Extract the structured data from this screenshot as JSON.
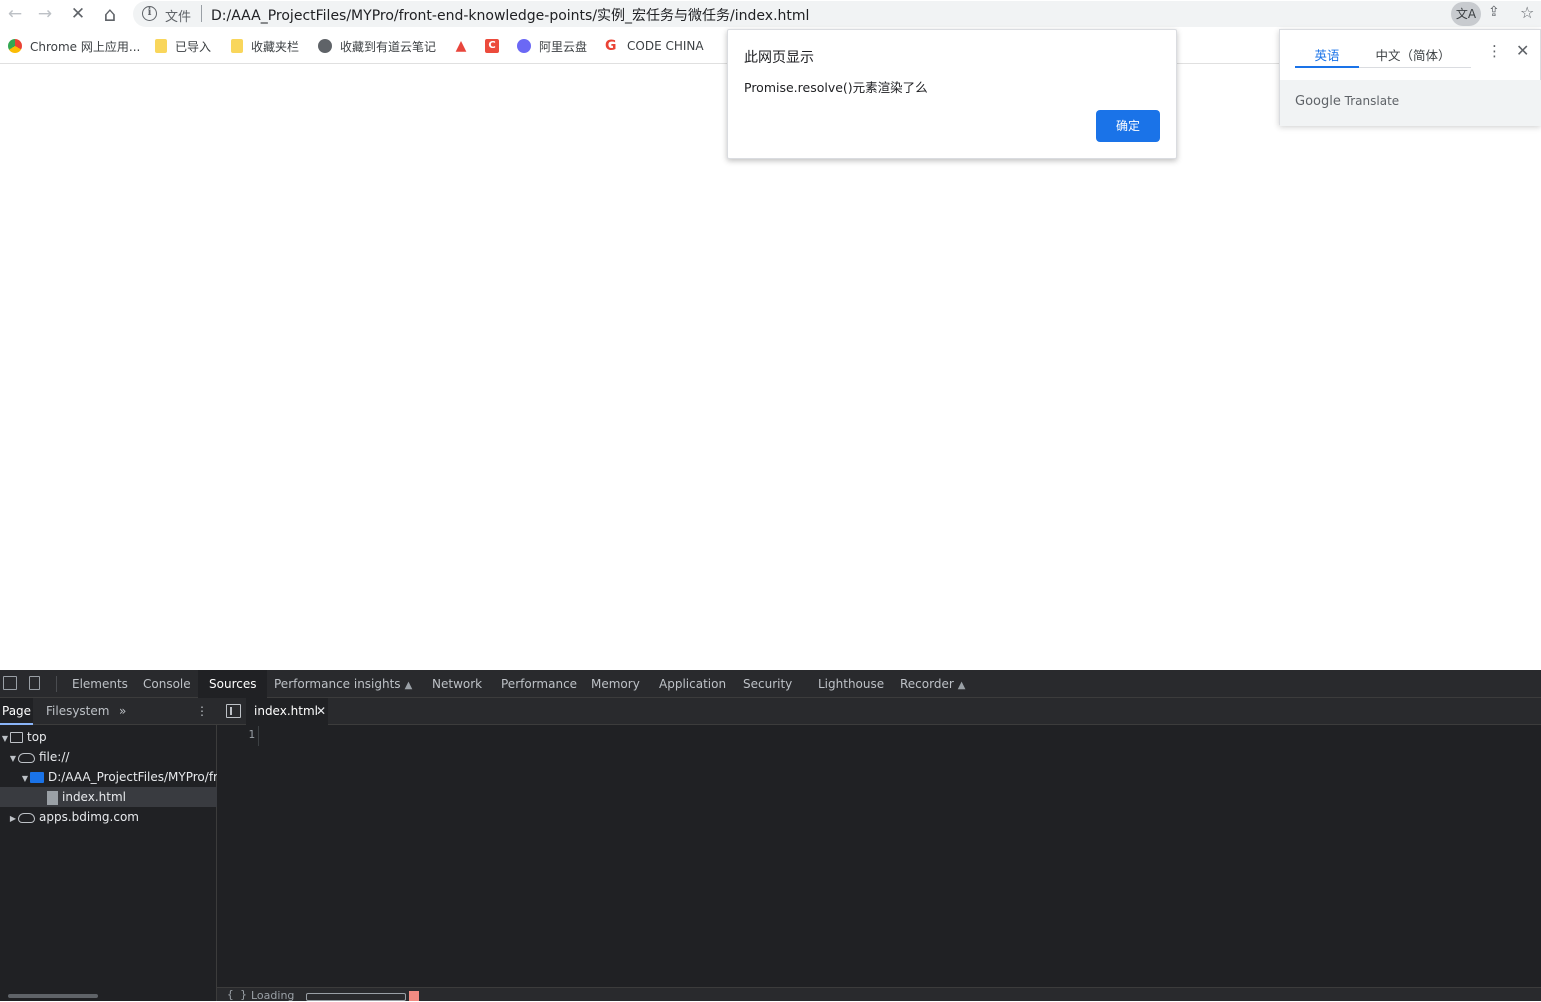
{
  "browser": {
    "url_scheme_label": "文件",
    "url": "D:/AAA_ProjectFiles/MYPro/front-end-knowledge-points/实例_宏任务与微任务/index.html",
    "nav": {
      "back": "←",
      "forward": "→",
      "stop": "✕",
      "home": "⌂"
    },
    "actions": {
      "translate": "文A",
      "share": "⇪",
      "star": "☆"
    }
  },
  "bookmarks": [
    {
      "label": "Chrome 网上应用...",
      "icon": "chrome-icon"
    },
    {
      "label": "已导入",
      "icon": "folder-icon"
    },
    {
      "label": "收藏夹栏",
      "icon": "folder-icon"
    },
    {
      "label": "收藏到有道云笔记",
      "icon": "globe-icon"
    },
    {
      "label": "",
      "icon": "flame-icon"
    },
    {
      "label": "",
      "icon": "csdn-icon"
    },
    {
      "label": "阿里云盘",
      "icon": "aliyun-icon"
    },
    {
      "label": "CODE CHINA",
      "icon": "google-icon"
    }
  ],
  "alert": {
    "title": "此网页显示",
    "message": "Promise.resolve()元素渲染了么",
    "ok_label": "确定"
  },
  "translate_bubble": {
    "tab_source": "英语",
    "tab_target": "中文（简体）",
    "more": "⋮",
    "close": "✕",
    "brand_google": "Google",
    "brand_translate": "Translate"
  },
  "devtools": {
    "tabs": [
      {
        "label": "Elements"
      },
      {
        "label": "Console"
      },
      {
        "label": "Sources"
      },
      {
        "label": "Performance insights"
      },
      {
        "label": "Network"
      },
      {
        "label": "Performance"
      },
      {
        "label": "Memory"
      },
      {
        "label": "Application"
      },
      {
        "label": "Security"
      },
      {
        "label": "Lighthouse"
      },
      {
        "label": "Recorder"
      }
    ],
    "active_tab": "Sources",
    "navigator_tabs": {
      "page": "Page",
      "filesystem": "Filesystem",
      "more": "»",
      "menu": "⋮"
    },
    "tree": {
      "top": "top",
      "file_origin": "file://",
      "folder": "D:/AAA_ProjectFiles/MYPro/fro",
      "file": "index.html",
      "other_origin": "apps.bdimg.com"
    },
    "editor": {
      "open_file": "index.html",
      "close": "✕",
      "line_number": "1"
    },
    "status": {
      "braces": "{ }",
      "text": "Loading"
    }
  }
}
